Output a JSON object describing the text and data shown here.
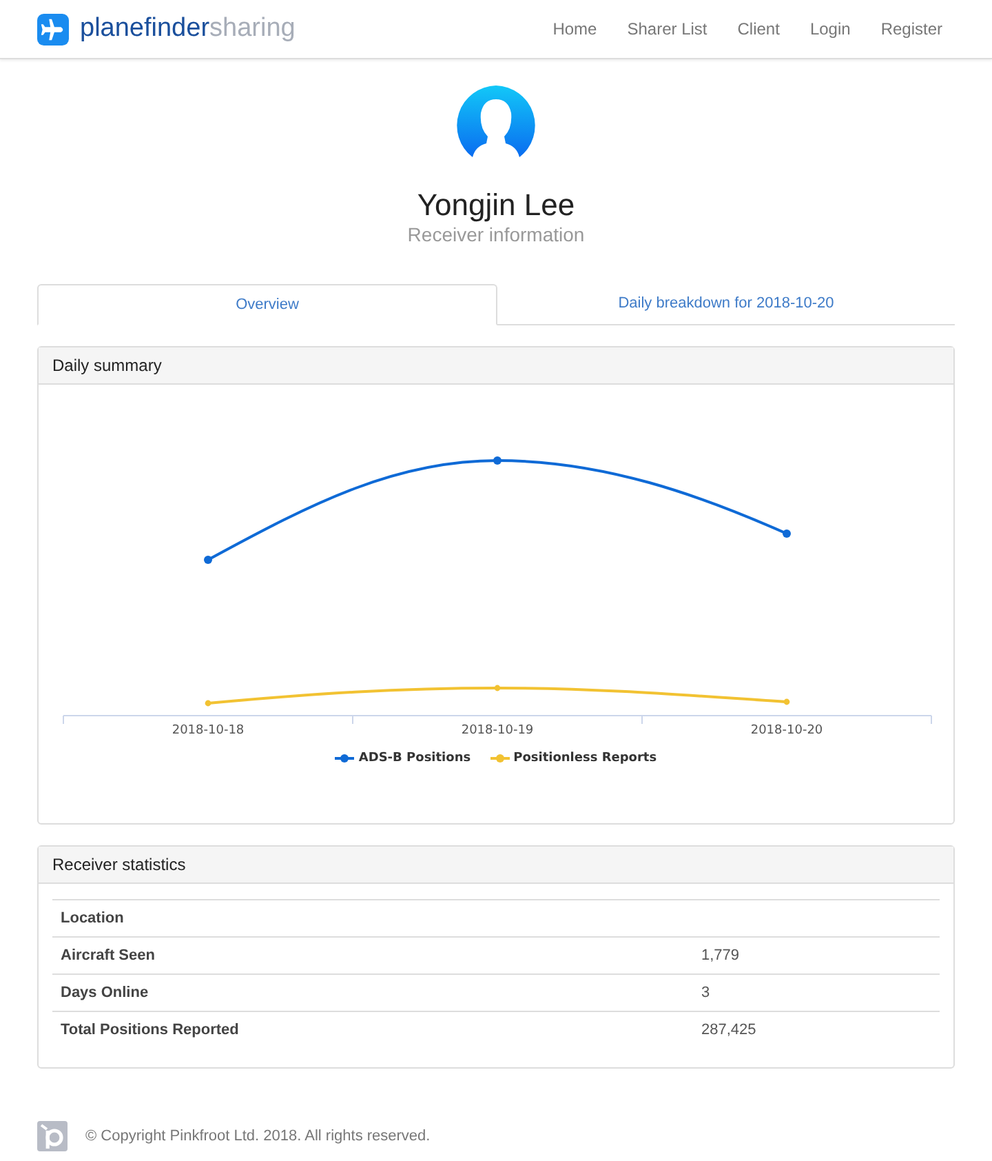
{
  "brand": {
    "name": "planefinder",
    "suffix": "sharing"
  },
  "nav": [
    "Home",
    "Sharer List",
    "Client",
    "Login",
    "Register"
  ],
  "profile": {
    "name": "Yongjin Lee",
    "subtitle": "Receiver information"
  },
  "tabs": [
    {
      "label": "Overview",
      "selected": true
    },
    {
      "label": "Daily breakdown for 2018-10-20",
      "selected": false
    }
  ],
  "summary": {
    "title": "Daily summary",
    "categories": [
      "2018-10-18",
      "2018-10-19",
      "2018-10-20"
    ],
    "legend": [
      {
        "name": "ADS-B Positions",
        "color": "#0f6ad6"
      },
      {
        "name": "Positionless Reports",
        "color": "#f2c232"
      }
    ]
  },
  "statistics": {
    "title": "Receiver statistics",
    "rows": [
      {
        "label": "Location"
      },
      {
        "label": "Aircraft Seen",
        "value": "1,779"
      },
      {
        "label": "Days Online",
        "value": "3"
      },
      {
        "label": "Total Positions Reported",
        "value": "287,425"
      }
    ]
  },
  "footer": "© Copyright Pinkfroot Ltd. 2018. All rights reserved."
}
